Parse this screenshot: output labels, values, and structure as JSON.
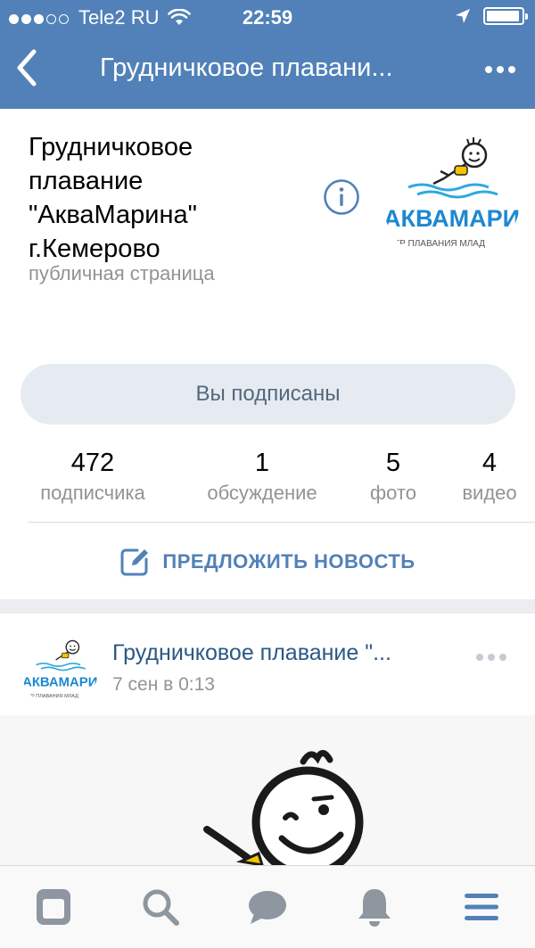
{
  "status_bar": {
    "carrier": "Tele2 RU",
    "time": "22:59",
    "signal_bars_filled": 3,
    "signal_bars_total": 5,
    "battery_level": 0.95,
    "icons": [
      "wifi-icon",
      "location-arrow-icon",
      "battery-icon"
    ]
  },
  "navbar": {
    "title": "Грудничковое плавани...",
    "icons": [
      "back-chevron-icon",
      "more-dots-icon"
    ]
  },
  "profile": {
    "name": "Грудничковое плавание \"АкваМарина\" г.Кемерово",
    "type": "публичная страница",
    "logo_text": "АКВАМАРИ",
    "logo_subtext": "ТР ПЛАВАНИЯ МЛАД",
    "subscribe_label": "Вы подписаны"
  },
  "counters": [
    {
      "value": "472",
      "label": "подписчика"
    },
    {
      "value": "1",
      "label": "обсуждение"
    },
    {
      "value": "5",
      "label": "фото"
    },
    {
      "value": "4",
      "label": "видео"
    }
  ],
  "suggest_label": "ПРЕДЛОЖИТЬ НОВОСТЬ",
  "post": {
    "author": "Грудничковое плавание \"...",
    "date": "7 сен в 0:13"
  },
  "tabbar": {
    "items": [
      "news-icon",
      "search-icon",
      "messages-icon",
      "notifications-icon",
      "menu-icon"
    ]
  },
  "colors": {
    "header": "#5181b8",
    "link": "#2a5885",
    "accent": "#5181b8",
    "secondary_text": "#939393",
    "button_bg": "#e5ebf1"
  }
}
